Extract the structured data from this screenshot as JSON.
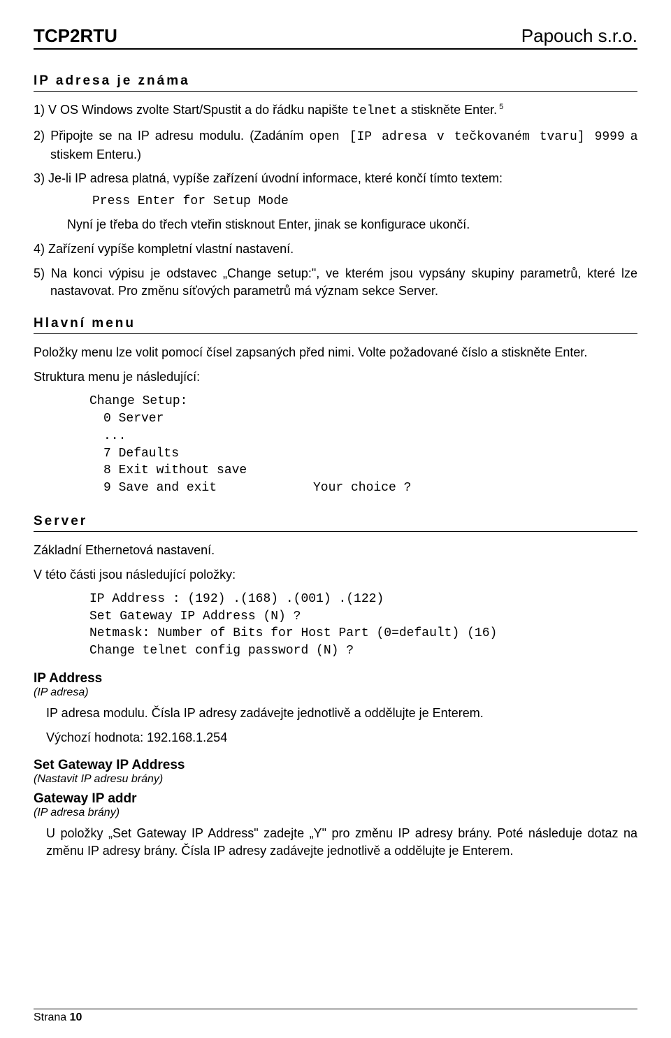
{
  "header": {
    "left": "TCP2RTU",
    "right": "Papouch s.r.o."
  },
  "section1": {
    "title": "IP adresa je známa",
    "items": {
      "i1_a": "1) V OS Windows zvolte Start/Spustit a do řádku napište ",
      "i1_b": "telnet",
      "i1_c": " a stiskněte Enter.",
      "i1_sup": " 5",
      "i2_a": "2) Připojte se na IP adresu modulu. (Zadáním ",
      "i2_b": "open [IP adresa v tečkovaném tvaru] 9999",
      "i2_c": " a stiskem Enteru.)",
      "i3_a": "3) Je-li IP adresa platná, vypíše zařízení úvodní informace, které končí tímto textem:",
      "i3_code": "Press Enter for Setup Mode",
      "i3_b": "Nyní je třeba do třech vteřin stisknout Enter, jinak se konfigurace ukončí.",
      "i4": "4) Zařízení vypíše kompletní vlastní nastavení.",
      "i5": "5) Na konci výpisu je odstavec „Change setup:\", ve kterém jsou vypsány skupiny parametrů, které lze nastavovat. Pro změnu síťových parametrů má význam sekce Server."
    }
  },
  "section2": {
    "title": "Hlavní menu",
    "p1": "Položky menu lze volit pomocí čísel zapsaných před nimi. Volte požadované číslo a stiskněte Enter.",
    "p2": "Struktura menu je následující:",
    "menu": {
      "l1": "Change Setup:",
      "l2": "0 Server",
      "l3": "...",
      "l4": "7 Defaults",
      "l5": "8 Exit without save",
      "l6a": "9 Save and exit",
      "l6b": "Your choice ?"
    }
  },
  "section3": {
    "title": "Server",
    "p1": "Základní Ethernetová nastavení.",
    "p2": "V této části jsou následující položky:",
    "code": {
      "l1": "IP Address : (192) .(168) .(001) .(122)",
      "l2": "Set Gateway IP Address (N) ?",
      "l3": "Netmask: Number of Bits for Host Part (0=default) (16)",
      "l4": "Change telnet config password (N) ?"
    },
    "def1": {
      "title": "IP Address",
      "sub": "(IP adresa)",
      "b1": "IP adresa modulu. Čísla IP adresy zadávejte jednotlivě a oddělujte je Enterem.",
      "b2": "Výchozí hodnota: 192.168.1.254"
    },
    "def2": {
      "title": "Set Gateway IP Address",
      "sub": "(Nastavit IP adresu brány)"
    },
    "def3": {
      "title": "Gateway IP addr",
      "sub": "(IP adresa brány)",
      "b1": "U položky „Set Gateway IP Address\" zadejte „Y\" pro změnu IP adresy brány. Poté následuje dotaz na změnu IP adresy brány. Čísla IP adresy zadávejte jednotlivě a oddělujte je Enterem."
    }
  },
  "footer": {
    "left_a": "Strana ",
    "left_b": "10"
  }
}
